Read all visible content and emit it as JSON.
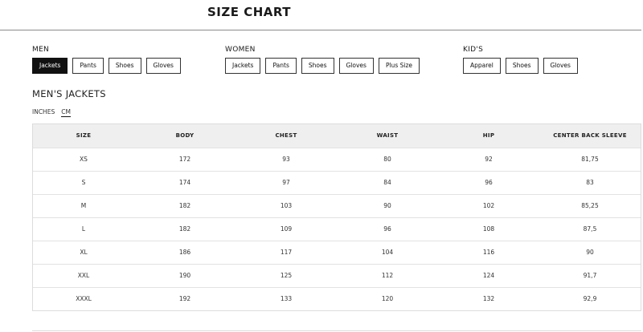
{
  "page": {
    "title": "SIZE CHART"
  },
  "groups": [
    {
      "label": "MEN",
      "buttons": [
        "Jackets",
        "Pants",
        "Shoes",
        "Gloves"
      ],
      "active": 0
    },
    {
      "label": "WOMEN",
      "buttons": [
        "Jackets",
        "Pants",
        "Shoes",
        "Gloves",
        "Plus Size"
      ],
      "active": -1
    },
    {
      "label": "KID'S",
      "buttons": [
        "Apparel",
        "Shoes",
        "Gloves"
      ],
      "active": -1
    }
  ],
  "section": {
    "title": "MEN'S JACKETS"
  },
  "units": {
    "inches": "INCHES",
    "cm": "CM",
    "active": "cm"
  },
  "table": {
    "headers": [
      "SIZE",
      "BODY",
      "CHEST",
      "WAIST",
      "HIP",
      "CENTER BACK SLEEVE"
    ],
    "rows": [
      [
        "XS",
        "172",
        "93",
        "80",
        "92",
        "81,75"
      ],
      [
        "S",
        "174",
        "97",
        "84",
        "96",
        "83"
      ],
      [
        "M",
        "182",
        "103",
        "90",
        "102",
        "85,25"
      ],
      [
        "L",
        "182",
        "109",
        "96",
        "108",
        "87,5"
      ],
      [
        "XL",
        "186",
        "117",
        "104",
        "116",
        "90"
      ],
      [
        "XXL",
        "190",
        "125",
        "112",
        "124",
        "91,7"
      ],
      [
        "XXXL",
        "192",
        "133",
        "120",
        "132",
        "92,9"
      ]
    ]
  }
}
